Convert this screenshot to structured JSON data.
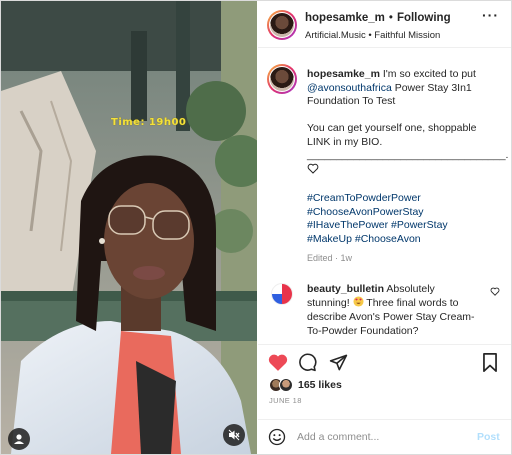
{
  "media": {
    "overlay_text": "Time: 19h00"
  },
  "header": {
    "username": "hopesamke_m",
    "separator": "•",
    "follow_label": "Following",
    "audio_label": "Artificial.Music • Faithful Mission",
    "more_label": "···"
  },
  "caption": {
    "username": "hopesamke_m",
    "line1_text": "I'm so excited to put",
    "mention": "@avonsouthafrica",
    "line2_text": "Power Stay 3In1",
    "line3": "Foundation To Test",
    "line4": "You can get yourself one, shoppable",
    "line5": "LINK in my BIO.",
    "line6": "__________________________________."
  },
  "hashtags": [
    "#CreamToPowderPower",
    "#ChooseAvonPowerStay",
    "#IHaveThePower #PowerStay",
    "#MakeUp #ChooseAvon"
  ],
  "edited": "Edited · 1w",
  "comment": {
    "username": "beauty_bulletin",
    "text_before": "Absolutely",
    "text_line2_a": "stunning!",
    "text_line2_b": "Three final words to",
    "text_line3": "describe Avon's Power Stay Cream-",
    "text_line4": "To-Powder Foundation?"
  },
  "likes": "165 likes",
  "date": "JUNE 18",
  "add_comment": {
    "placeholder": "Add a comment...",
    "post_label": "Post"
  },
  "colors": {
    "like_red": "#ed4956",
    "link_blue": "#00376b",
    "post_disabled": "#b2dffc",
    "overlay_yellow": "#f4e13a"
  }
}
